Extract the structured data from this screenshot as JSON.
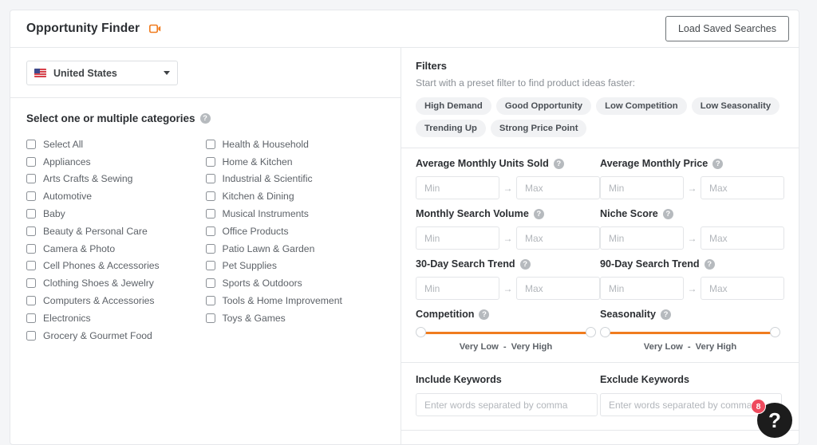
{
  "header": {
    "title": "Opportunity Finder",
    "video_icon": "video-camera-icon",
    "load_saved_label": "Load Saved Searches"
  },
  "country": {
    "name": "United States",
    "flag_icon": "us-flag-icon",
    "caret_icon": "chevron-down-icon"
  },
  "categories": {
    "heading": "Select one or multiple categories",
    "help_icon": "help-icon",
    "column_left": [
      "Select All",
      "Appliances",
      "Arts Crafts & Sewing",
      "Automotive",
      "Baby",
      "Beauty & Personal Care",
      "Camera & Photo",
      "Cell Phones & Accessories",
      "Clothing Shoes & Jewelry",
      "Computers & Accessories",
      "Electronics",
      "Grocery & Gourmet Food"
    ],
    "column_right": [
      "Health & Household",
      "Home & Kitchen",
      "Industrial & Scientific",
      "Kitchen & Dining",
      "Musical Instruments",
      "Office Products",
      "Patio Lawn & Garden",
      "Pet Supplies",
      "Sports & Outdoors",
      "Tools & Home Improvement",
      "Toys & Games"
    ]
  },
  "filters": {
    "title": "Filters",
    "subtitle": "Start with a preset filter to find product ideas faster:",
    "presets": [
      "High Demand",
      "Good Opportunity",
      "Low Competition",
      "Low Seasonality",
      "Trending Up",
      "Strong Price Point"
    ],
    "min_placeholder": "Min",
    "max_placeholder": "Max",
    "range_arrow": "→",
    "ranges": [
      {
        "label": "Average Monthly Units Sold",
        "min": "",
        "max": ""
      },
      {
        "label": "Average Monthly Price",
        "min": "",
        "max": ""
      },
      {
        "label": "Monthly Search Volume",
        "min": "",
        "max": ""
      },
      {
        "label": "Niche Score",
        "min": "",
        "max": ""
      },
      {
        "label": "30-Day Search Trend",
        "min": "",
        "max": ""
      },
      {
        "label": "90-Day Search Trend",
        "min": "",
        "max": ""
      }
    ],
    "sliders": [
      {
        "label": "Competition",
        "low_label": "Very Low",
        "sep": "-",
        "high_label": "Very High",
        "low_value": 0,
        "high_value": 100
      },
      {
        "label": "Seasonality",
        "low_label": "Very Low",
        "sep": "-",
        "high_label": "Very High",
        "low_value": 0,
        "high_value": 100
      }
    ],
    "accent_color": "#f07c1f",
    "keywords": [
      {
        "label": "Include Keywords",
        "placeholder": "Enter words separated by comma",
        "value": ""
      },
      {
        "label": "Exclude Keywords",
        "placeholder": "Enter words separated by comma",
        "value": ""
      }
    ]
  },
  "help_widget": {
    "glyph": "?",
    "badge_count": "8",
    "badge_color": "#ef4b5e"
  }
}
